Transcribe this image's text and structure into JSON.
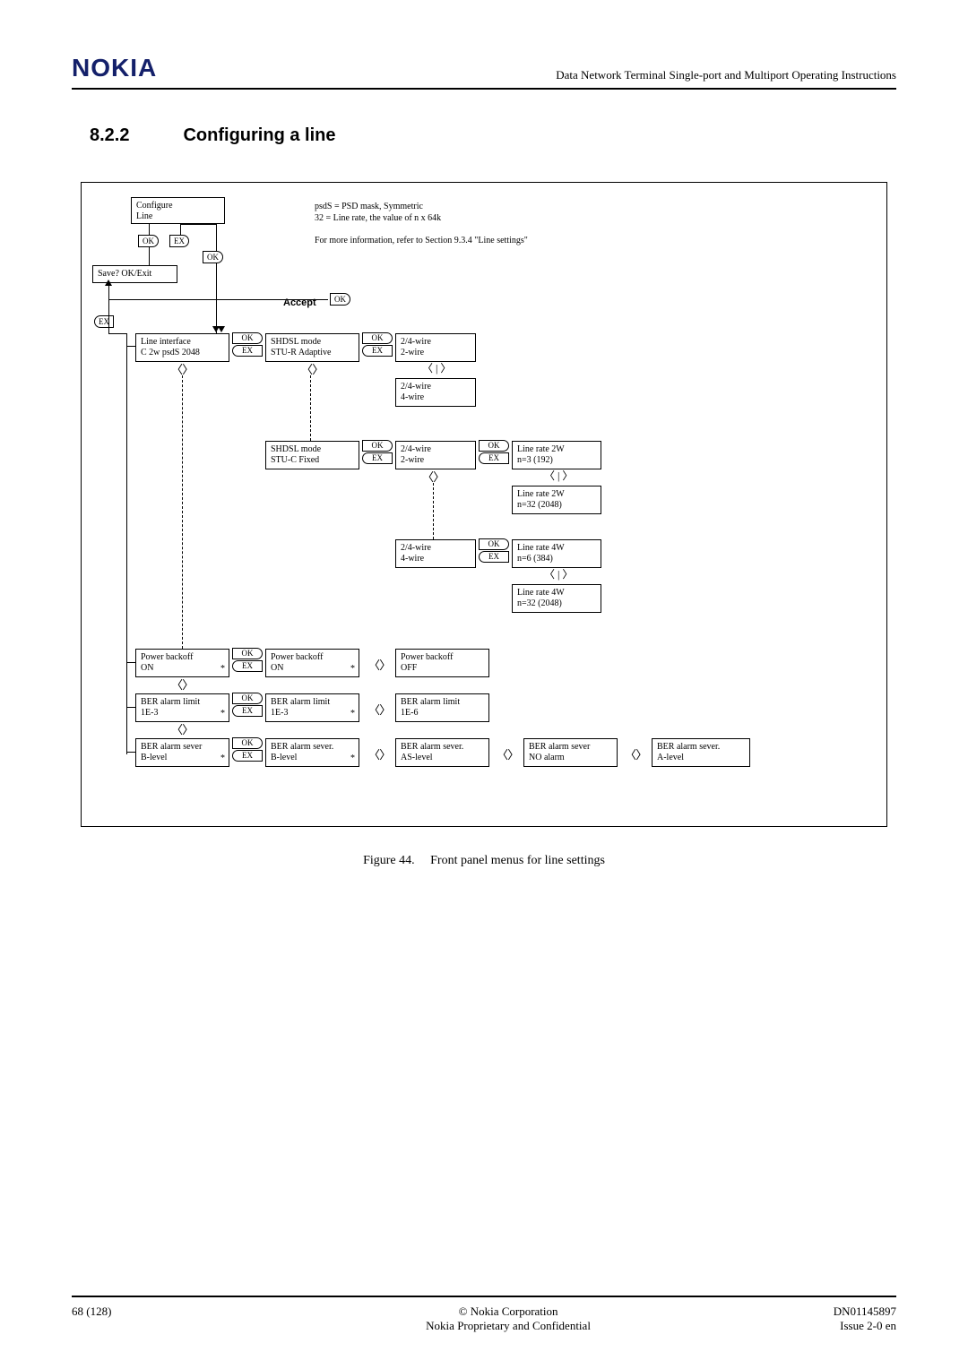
{
  "header": {
    "logo": "NOKIA",
    "doc_title": "Data Network Terminal Single-port and Multiport Operating Instructions"
  },
  "section": {
    "number": "8.2.2",
    "title": "Configuring a line"
  },
  "diagram": {
    "configure_line": "Configure\nLine",
    "save_exit": "Save? OK/Exit",
    "ok": "OK",
    "ex": "EX",
    "note_line1": "psdS = PSD mask, Symmetric",
    "note_line2": "32 = Line rate, the value of n x 64k",
    "note_line3": "For more information, refer to Section 9.3.4 \"Line settings\"",
    "accept": "Accept",
    "line_interface_l1": "Line interface",
    "line_interface_l2": "C 2w psdS 2048",
    "shdsl_adaptive_l1": "SHDSL mode",
    "shdsl_adaptive_l2": "STU-R Adaptive",
    "shdsl_fixed_l1": "SHDSL mode",
    "shdsl_fixed_l2": "STU-C Fixed",
    "w24_2wire_l1": "2/4-wire",
    "w24_2wire_l2": "2-wire",
    "w24_4wire_l1": "2/4-wire",
    "w24_4wire_l2": "4-wire",
    "rate2w_a_l1": "Line rate 2W",
    "rate2w_a_l2": "n=3 (192)",
    "rate2w_b_l1": "Line rate 2W",
    "rate2w_b_l2": "n=32 (2048)",
    "rate4w_a_l1": "Line rate 4W",
    "rate4w_a_l2": "n=6 (384)",
    "rate4w_b_l1": "Line rate 4W",
    "rate4w_b_l2": "n=32 (2048)",
    "pbo_on_l1": "Power backoff",
    "pbo_on_l2": "ON",
    "pbo_on2_l1": "Power backoff",
    "pbo_on2_l2": "ON",
    "pbo_off_l1": "Power backoff",
    "pbo_off_l2": "OFF",
    "ber_lim_l1": "BER alarm limit",
    "ber_lim_l2": "1E-3",
    "ber_lim2_l1": "BER alarm limit",
    "ber_lim2_l2": "1E-3",
    "ber_lim3_l1": "BER alarm limit",
    "ber_lim3_l2": "1E-6",
    "ber_sev_l1": "BER alarm sever",
    "ber_sev_l2": "B-level",
    "ber_sev2_l1": "BER alarm sever.",
    "ber_sev2_l2": "B-level",
    "ber_sev3_l1": "BER alarm sever.",
    "ber_sev3_l2": "AS-level",
    "ber_sev4_l1": "BER alarm sever",
    "ber_sev4_l2": "NO alarm",
    "ber_sev5_l1": "BER alarm sever.",
    "ber_sev5_l2": "A-level",
    "asterisk": "*"
  },
  "caption": {
    "label": "Figure 44.",
    "text": "Front panel menus for line settings"
  },
  "footer": {
    "page": "68 (128)",
    "copyright": "© Nokia Corporation",
    "confidential": "Nokia Proprietary and Confidential",
    "doc_number": "DN01145897",
    "issue": "Issue 2-0 en"
  }
}
